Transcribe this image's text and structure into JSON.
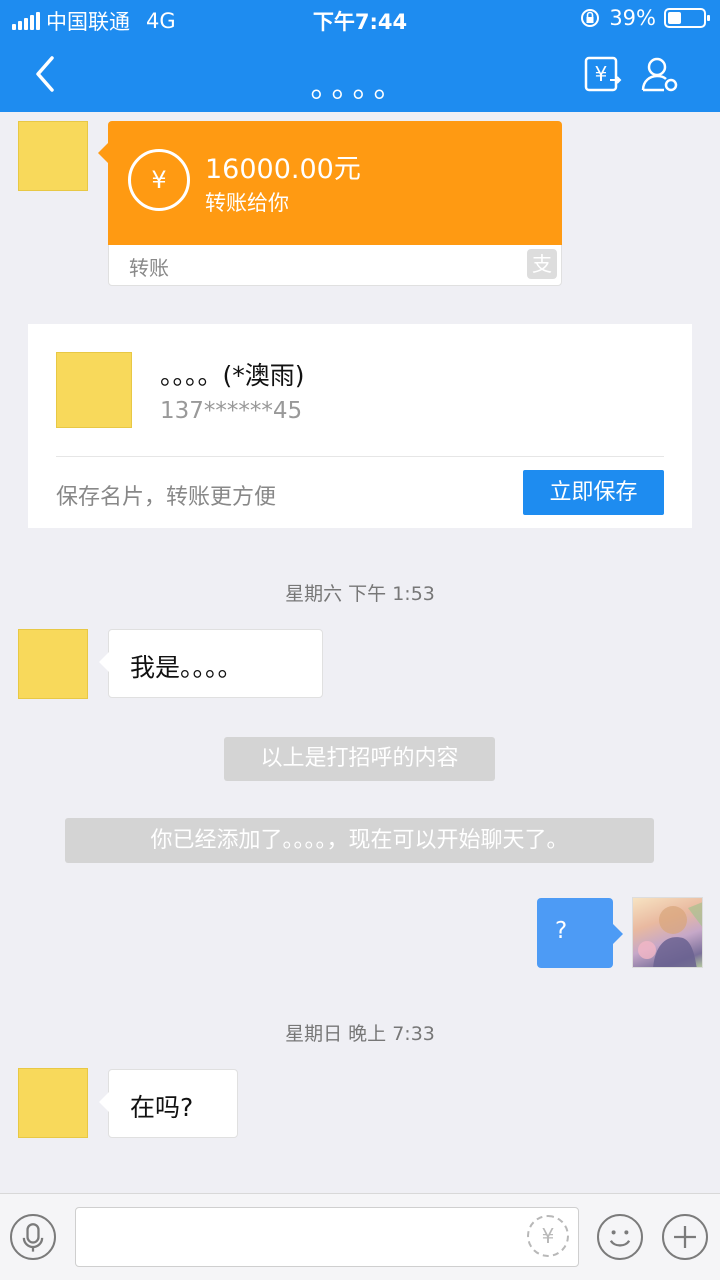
{
  "statusbar": {
    "carrier": "中国联通",
    "network": "4G",
    "time": "下午7:44",
    "battery_percent": "39%",
    "battery_level": 0.39
  },
  "navbar": {
    "title": "。。。。"
  },
  "transfer": {
    "amount": "16000.00元",
    "subtitle": "转账给你",
    "footer_label": "转账",
    "yuan_symbol": "¥",
    "alipay_mark": "支"
  },
  "contact_card": {
    "name": "。。。。(*澳雨)",
    "phone": "137******45",
    "tip": "保存名片，转账更方便",
    "save_button": "立即保存"
  },
  "messages": {
    "timestamp_1": "星期六 下午 1:53",
    "msg_1": "我是。。。。",
    "system_1": "以上是打招呼的内容",
    "system_2": "你已经添加了。。。。，现在可以开始聊天了。",
    "msg_me": "?",
    "timestamp_2": "星期日 晚上 7:33",
    "msg_2": "在吗?"
  },
  "inputbar": {
    "placeholder": "",
    "yuan_symbol": "¥"
  },
  "colors": {
    "brand_blue": "#1e8cf0",
    "transfer_orange": "#ff9a12",
    "my_bubble": "#4d9bf5"
  }
}
